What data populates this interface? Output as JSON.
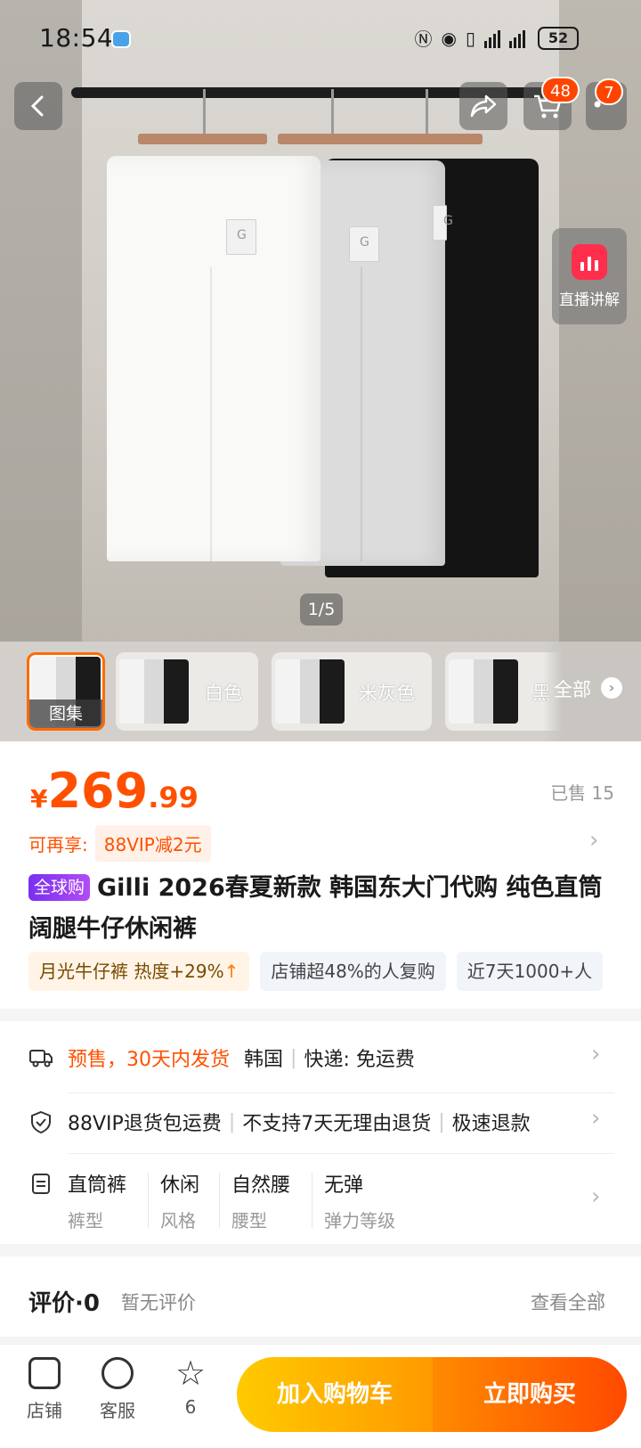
{
  "status_bar": {
    "time": "18:54",
    "battery": "52",
    "icons": [
      "nfc-icon",
      "location-icon",
      "vibrate-icon",
      "signal-icon",
      "signal-icon",
      "battery-icon"
    ]
  },
  "nav": {
    "cart_count": "48",
    "more_count": "7"
  },
  "hero": {
    "counter": "1/5",
    "live_label": "直播讲解"
  },
  "thumbs": {
    "items": [
      {
        "label": "图集"
      },
      {
        "label": "白色"
      },
      {
        "label": "米灰色"
      },
      {
        "label": "黑"
      }
    ],
    "all_label": "全部"
  },
  "product": {
    "currency": "¥",
    "price_int": "269",
    "price_dec": ".99",
    "sold": "已售 15",
    "promo_label": "可再享:",
    "promo_chip": "88VIP减2元",
    "global_tag": "全球购",
    "title": "Gilli 2026春夏新款 韩国东大门代购 纯色直筒阔腿牛仔休闲裤",
    "chips": [
      {
        "text": "月光牛仔裤 热度+29%",
        "arrow": "↑"
      },
      {
        "text": "店铺超48%的人复购"
      },
      {
        "text": "近7天1000+人"
      }
    ]
  },
  "service": {
    "delivery": {
      "presale": "预售，30天内发货",
      "origin": "韩国",
      "express": "快递: 免运费"
    },
    "guarantee": {
      "a": "88VIP退货包运费",
      "b": "不支持7天无理由退货",
      "c": "极速退款"
    },
    "specs": [
      {
        "value": "直筒裤",
        "key": "裤型"
      },
      {
        "value": "休闲",
        "key": "风格"
      },
      {
        "value": "自然腰",
        "key": "腰型"
      },
      {
        "value": "无弹",
        "key": "弹力等级"
      }
    ]
  },
  "review": {
    "title": "评价·0",
    "empty": "暂无评价",
    "all": "查看全部"
  },
  "bottom": {
    "shop": "店铺",
    "service": "客服",
    "fav_count": "6",
    "add_cart": "加入购物车",
    "buy_now": "立即购买"
  },
  "colors": {
    "accent": "#ff5000",
    "cart_gradient_start": "#ffca00",
    "buy_gradient_end": "#ff4a00",
    "global_tag": "#7a2ff0"
  }
}
